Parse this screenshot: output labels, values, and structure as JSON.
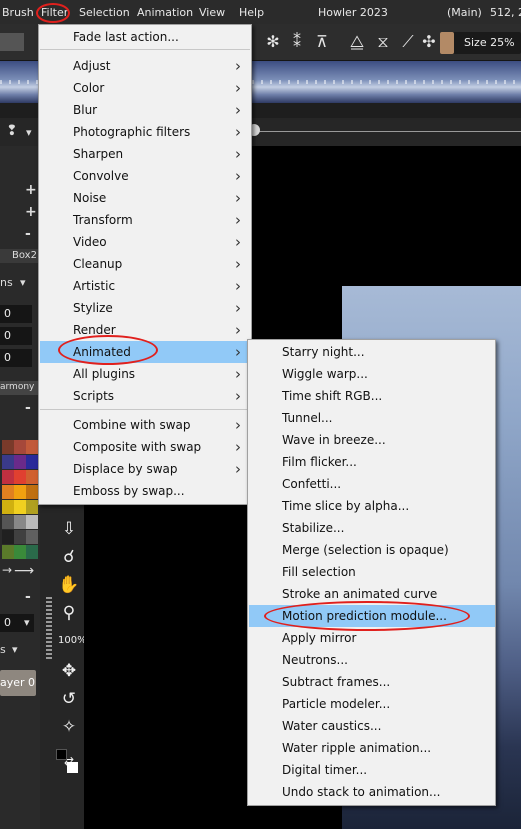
{
  "menubar": {
    "items": [
      "Brush",
      "Filter",
      "Selection",
      "Animation",
      "View",
      "Help"
    ],
    "app_title": "Howler 2023",
    "status": "(Main)",
    "coords": "512, 2"
  },
  "toolbar": {
    "size_label": "Size 25%",
    "size_swatch_color": "#b38a66"
  },
  "left_panel": {
    "tabs": [
      "Box2"
    ],
    "mode_label": "ns",
    "field_values": [
      "0",
      "0",
      "0",
      "0"
    ],
    "harmony_label": "armony",
    "layer_label": "ayer 0",
    "zoom_label": "100%",
    "section_label": "s"
  },
  "filter_menu": {
    "items": [
      {
        "label": "Fade last action...",
        "submenu": false
      },
      {
        "label": "Adjust",
        "submenu": true
      },
      {
        "label": "Color",
        "submenu": true
      },
      {
        "label": "Blur",
        "submenu": true
      },
      {
        "label": "Photographic filters",
        "submenu": true
      },
      {
        "label": "Sharpen",
        "submenu": true
      },
      {
        "label": "Convolve",
        "submenu": true
      },
      {
        "label": "Noise",
        "submenu": true
      },
      {
        "label": "Transform",
        "submenu": true
      },
      {
        "label": "Video",
        "submenu": true
      },
      {
        "label": "Cleanup",
        "submenu": true
      },
      {
        "label": "Artistic",
        "submenu": true
      },
      {
        "label": "Stylize",
        "submenu": true
      },
      {
        "label": "Render",
        "submenu": true
      },
      {
        "label": "Animated",
        "submenu": true
      },
      {
        "label": "All plugins",
        "submenu": true
      },
      {
        "label": "Scripts",
        "submenu": true
      },
      {
        "label": "Combine with swap",
        "submenu": true
      },
      {
        "label": "Composite with swap",
        "submenu": true
      },
      {
        "label": "Displace by swap",
        "submenu": true
      },
      {
        "label": "Emboss by swap...",
        "submenu": false
      }
    ],
    "highlighted": "Animated"
  },
  "animated_submenu": {
    "items": [
      "Starry night...",
      "Wiggle warp...",
      "Time shift RGB...",
      "Tunnel...",
      "Wave in breeze...",
      "Film flicker...",
      "Confetti...",
      "Time slice by alpha...",
      "Stabilize...",
      "Merge (selection is opaque)",
      "Fill selection",
      "Stroke an animated curve",
      "Motion prediction module...",
      "Apply mirror",
      "Neutrons...",
      "Subtract frames...",
      "Particle modeler...",
      "Water caustics...",
      "Water ripple animation...",
      "Digital timer...",
      "Undo stack to animation..."
    ],
    "highlighted": "Motion prediction module..."
  },
  "palette_colors": [
    "#7a3a2a",
    "#a6483a",
    "#c25a3a",
    "#3a3a8a",
    "#6a2a8a",
    "#2a2a9a",
    "#c03040",
    "#e04030",
    "#d06030",
    "#e08020",
    "#f0a010",
    "#c07010",
    "#d0b010",
    "#f0d020",
    "#b0a020",
    "#555555",
    "#888888",
    "#bbbbbb",
    "#202020",
    "#404040",
    "#606060",
    "#5a7a2a",
    "#3a8a3a",
    "#2a6a4a"
  ]
}
